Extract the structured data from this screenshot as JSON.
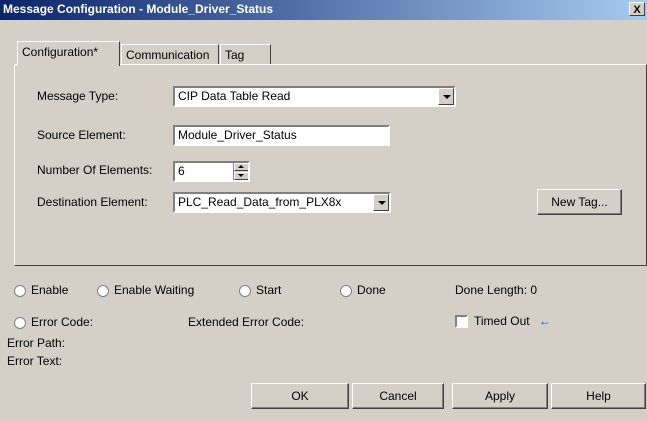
{
  "window": {
    "title": "Message Configuration - Module_Driver_Status",
    "close_label": "X"
  },
  "tabs": [
    {
      "label": "Configuration*",
      "active": true
    },
    {
      "label": "Communication",
      "active": false
    },
    {
      "label": "Tag",
      "active": false
    }
  ],
  "configuration": {
    "message_type_label": "Message Type:",
    "message_type_value": "CIP Data Table Read",
    "source_element_label": "Source Element:",
    "source_element_value": "Module_Driver_Status",
    "number_of_elements_label": "Number Of Elements:",
    "number_of_elements_value": "6",
    "destination_element_label": "Destination Element:",
    "destination_element_value": "PLC_Read_Data_from_PLX8x",
    "new_tag_label": "New Tag..."
  },
  "status": {
    "enable": "Enable",
    "enable_waiting": "Enable Waiting",
    "start": "Start",
    "done": "Done",
    "done_length": "Done Length: 0",
    "error_code": "Error Code:",
    "extended_error_code": "Extended Error Code:",
    "timed_out": "Timed Out",
    "error_path": "Error Path:",
    "error_text": "Error Text:"
  },
  "buttons": {
    "ok": "OK",
    "cancel": "Cancel",
    "apply": "Apply",
    "help": "Help"
  },
  "icons": {
    "timed_out_arrow": "left-arrow-icon"
  }
}
